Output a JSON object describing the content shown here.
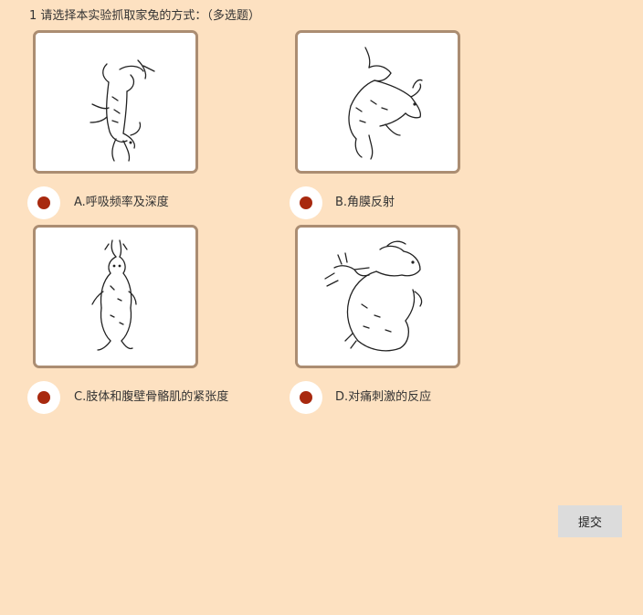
{
  "question": {
    "title": "1 请选择本实验抓取家兔的方式：（多选题）"
  },
  "options": [
    {
      "label": "A.呼吸频率及深度",
      "image_icon": "rabbit-held-by-ears-back-icon",
      "selected": true
    },
    {
      "label": "B.角膜反射",
      "image_icon": "rabbit-held-by-scruff-icon",
      "selected": true
    },
    {
      "label": "C.肢体和腹壁骨骼肌的紧张度",
      "image_icon": "rabbit-hanging-by-ears-icon",
      "selected": true
    },
    {
      "label": "D.对痛刺激的反应",
      "image_icon": "rabbit-held-in-arms-icon",
      "selected": true
    }
  ],
  "submit": {
    "label": "提交"
  },
  "colors": {
    "background": "#fde1c1",
    "image_border": "#ab8d72",
    "radio_dot": "#a8290f",
    "button": "#dcdcdc"
  }
}
